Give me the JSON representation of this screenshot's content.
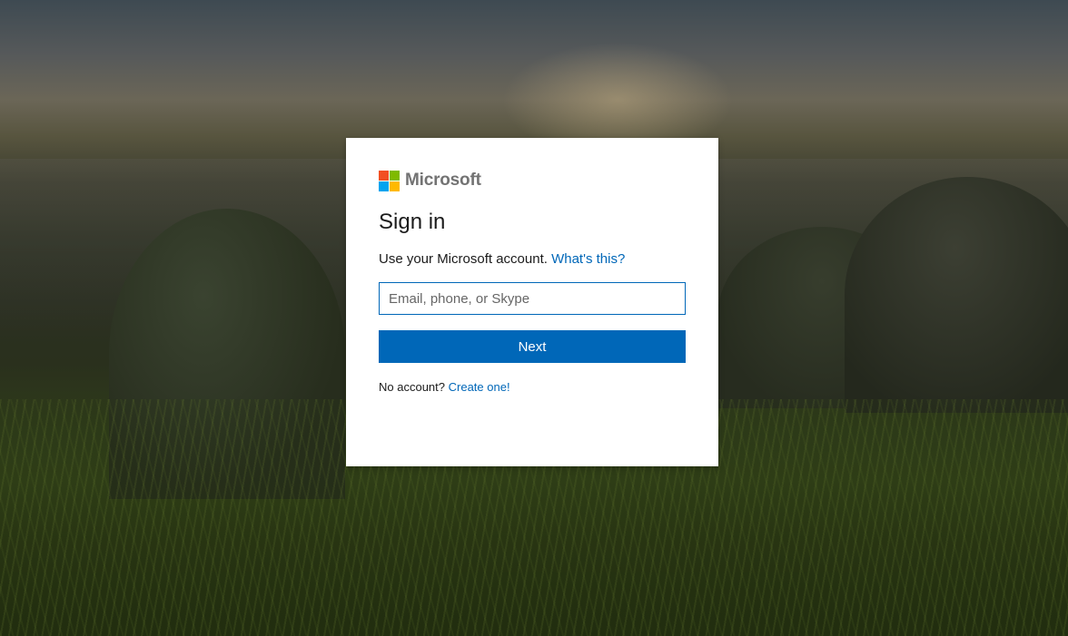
{
  "brand": {
    "name": "Microsoft",
    "logo_colors": [
      "#f25022",
      "#7fba00",
      "#00a4ef",
      "#ffb900"
    ]
  },
  "signin": {
    "title": "Sign in",
    "subtitle": "Use your Microsoft account.",
    "whats_this_link": "What's this?",
    "email_placeholder": "Email, phone, or Skype",
    "email_value": "",
    "next_label": "Next",
    "no_account_text": "No account?",
    "create_link": "Create one!"
  },
  "colors": {
    "accent": "#0067b8",
    "text": "#1b1b1b",
    "brand_text": "#737373"
  }
}
